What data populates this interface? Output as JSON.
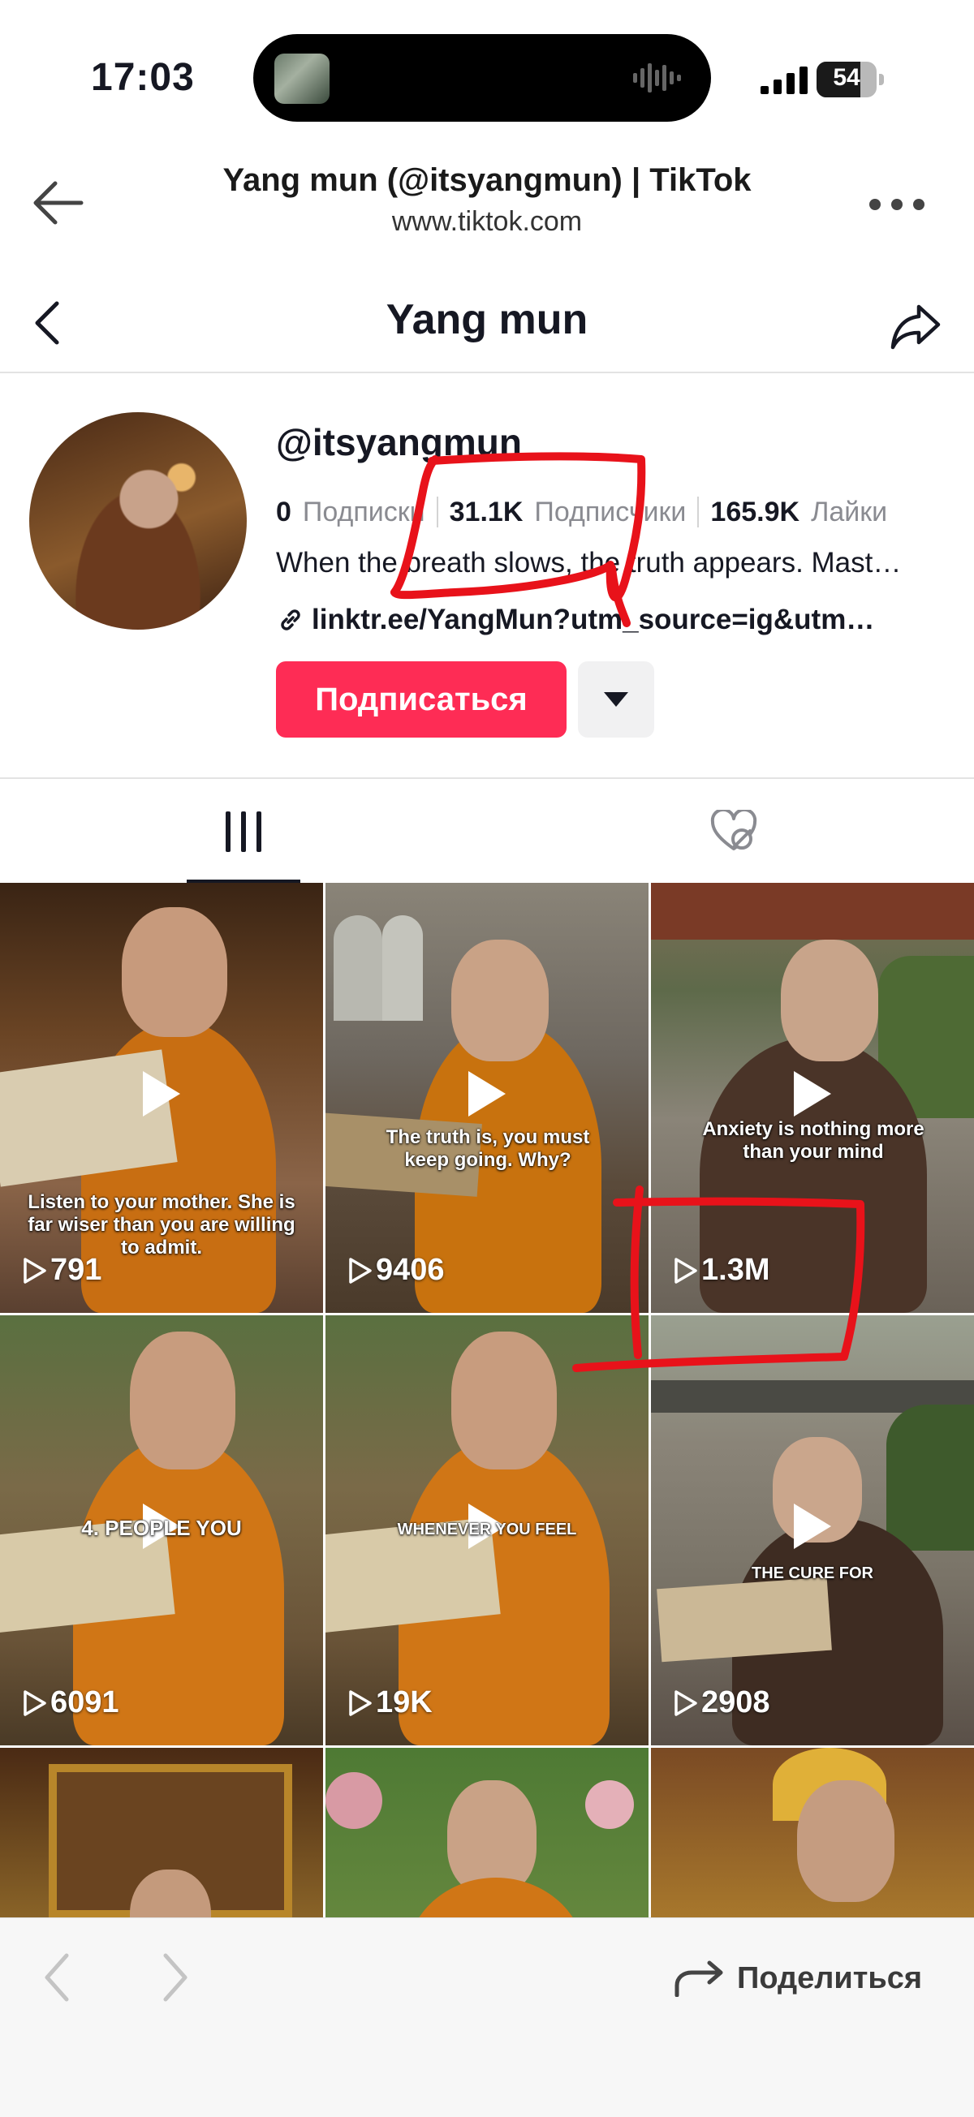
{
  "status_bar": {
    "time": "17:03",
    "battery": "54"
  },
  "browser": {
    "title": "Yang mun (@itsyangmun) | TikTok",
    "url": "www.tiktok.com"
  },
  "header": {
    "title": "Yang mun"
  },
  "profile": {
    "handle": "@itsyangmun",
    "following_count": "0",
    "following_label": "Подписки",
    "followers_count": "31.1K",
    "followers_label": "Подписчики",
    "likes_count": "165.9K",
    "likes_label": "Лайки",
    "bio": "When the breath slows, the truth appears. Mast…",
    "link": "linktr.ee/YangMun?utm_source=ig&utm…",
    "follow_button": "Подписаться"
  },
  "videos": [
    {
      "views": "791",
      "caption": "Listen to your mother. She is far wiser than you are willing to admit."
    },
    {
      "views": "9406",
      "caption": "The truth is, you must keep going. Why?"
    },
    {
      "views": "1.3M",
      "caption": "Anxiety is nothing more than your mind"
    },
    {
      "views": "6091",
      "caption": "4. PEOPLE YOU"
    },
    {
      "views": "19K",
      "caption": "WHENEVER YOU FEEL"
    },
    {
      "views": "2908",
      "caption": "THE CURE FOR"
    }
  ],
  "bottom_bar": {
    "share_label": "Поделиться"
  },
  "colors": {
    "accent": "#fe2c55",
    "annotation": "#e8121a"
  }
}
